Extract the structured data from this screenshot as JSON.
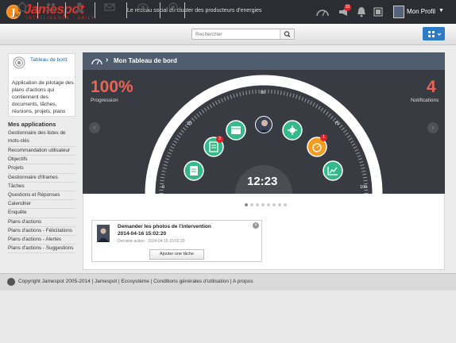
{
  "brand": {
    "badge": "J",
    "name": "Jamespot",
    "subtitle": "INTELLIGENCE · DAILY"
  },
  "header": {
    "tagline": "Le réseau social du cluster des producteurs d'energies",
    "notification_count": "33",
    "profile_label": "Mon Profil"
  },
  "nav": {
    "items": [
      {
        "label": "Accueil",
        "icon": "home-icon"
      },
      {
        "label": "Groupes",
        "icon": "groups-icon"
      },
      {
        "label": "Contacts",
        "icon": "contacts-icon"
      },
      {
        "label": "Messages",
        "icon": "mail-icon"
      },
      {
        "label": "Découverte",
        "icon": "compass-icon"
      },
      {
        "label": "Apps",
        "icon": "apps-icon"
      }
    ],
    "search_placeholder": "Rechercher"
  },
  "sidebar": {
    "card_title": "Tableau de bord",
    "card_description": "Application de pilotage des plans d'actions qui contiennent des documents, tâches, réunions, projets, plans",
    "apps_heading": "Mes applications",
    "apps": [
      "Gestionnaire des listes de mots-clés",
      "Recommandation utilisateur",
      "Objectifs",
      "Projets",
      "Gestionnaire d'iframes",
      "Tâches",
      "Questions et Réponses",
      "Calendrier",
      "Enquête",
      "Plans d'actions",
      "Plans d'actions - Félicitations",
      "Plans d'actions - Alertes",
      "Plans d'actions - Suggestions"
    ]
  },
  "dashboard": {
    "title": "Mon Tableau de bord",
    "progress_value": "100%",
    "progress_label": "Progression",
    "notifications_value": "4",
    "notifications_label": "Notifications",
    "ticks": [
      "0",
      "25",
      "50",
      "75",
      "100"
    ],
    "clock": "12:23",
    "bubble_badges": [
      "3",
      "1"
    ],
    "colors": {
      "accent": "#ef6355",
      "bubble": "#35b88a",
      "alert": "#f59a1c",
      "dark": "#383b42"
    },
    "page_count": 8,
    "active_page": 1
  },
  "task": {
    "title": "Demander les photos de l'intervention",
    "date": "2014-04-16 15:02:20",
    "last_action": "Dernière action : 2014-04-16 15:02:20",
    "button": "Ajouter une tâche"
  },
  "footer": {
    "text": "Copyright Jamespot 2005-2014  |  Jamespot  |  Ecosystème  |  Conditions générales d'utilisation  |  A propos"
  }
}
